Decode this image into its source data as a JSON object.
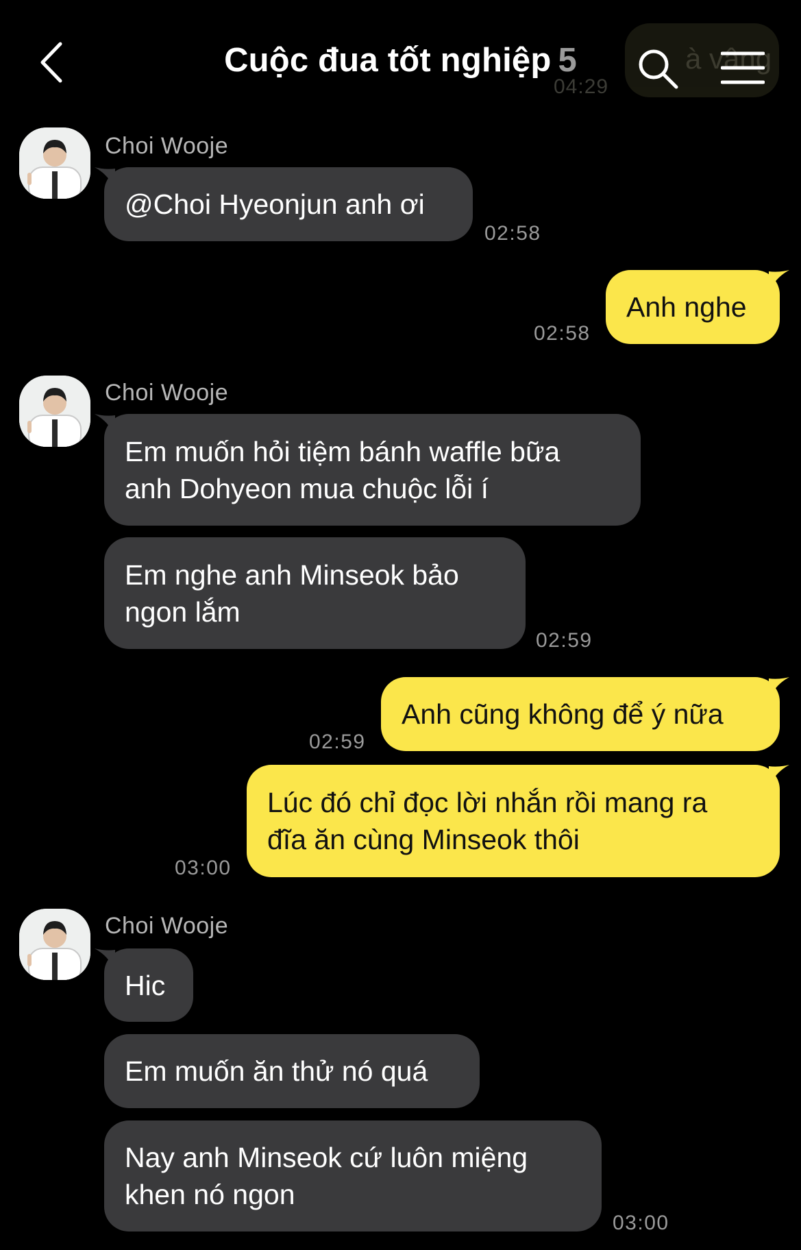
{
  "header": {
    "title": "Cuộc đua tốt nghiệp",
    "member_count": "5",
    "back_icon": "chevron-left-icon",
    "search_icon": "search-icon",
    "menu_icon": "hamburger-menu-icon",
    "overlay_preview_text": "à vâng",
    "overlay_preview_time": "04:29"
  },
  "colors": {
    "background": "#000000",
    "incoming_bubble": "#3a3a3c",
    "outgoing_bubble": "#fbe64b",
    "timestamp": "#9a9a9a",
    "sender_name": "#b7b7b7"
  },
  "messages": {
    "m1": {
      "sender": "Choi Wooje",
      "text": "@Choi Hyeonjun anh ơi",
      "time": "02:58"
    },
    "m2": {
      "text": "Anh nghe",
      "time": "02:58"
    },
    "m3": {
      "sender": "Choi Wooje",
      "line1": "Em muốn hỏi tiệm bánh waffle bữa",
      "line2": "anh Dohyeon mua chuộc lỗi í"
    },
    "m4": {
      "line1": "Em nghe anh Minseok bảo",
      "line2": "ngon lắm",
      "time": "02:59"
    },
    "m5": {
      "text": "Anh cũng không để ý nữa",
      "time": "02:59"
    },
    "m6": {
      "line1": "Lúc đó chỉ đọc lời nhắn rồi mang ra",
      "line2": "đĩa ăn cùng Minseok thôi",
      "time": "03:00"
    },
    "m7": {
      "sender": "Choi Wooje",
      "text": "Hic"
    },
    "m8": {
      "text": "Em muốn ăn thử nó quá"
    },
    "m9": {
      "line1": "Nay anh Minseok cứ luôn miệng",
      "line2": "khen nó ngon",
      "time": "03:00"
    }
  }
}
